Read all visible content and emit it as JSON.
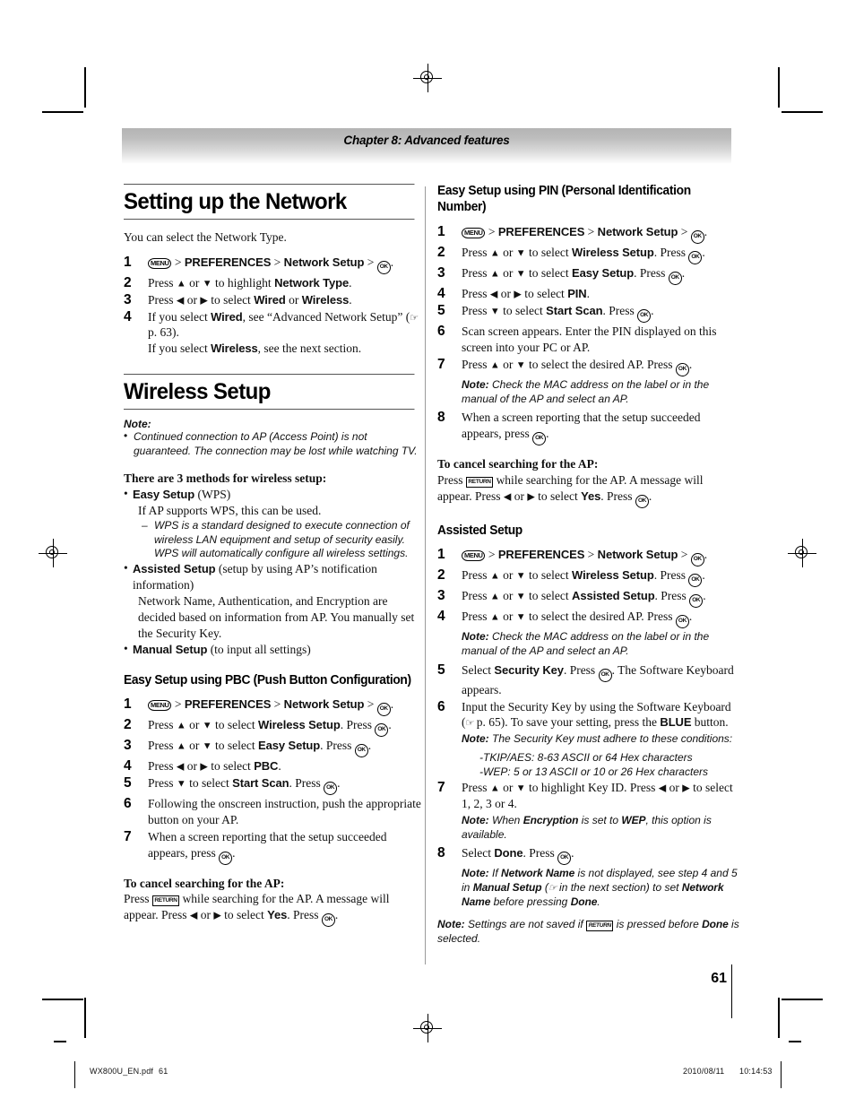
{
  "page": {
    "chapter": "Chapter 8: Advanced features",
    "page_number": "61"
  },
  "footer": {
    "file_label": "WX800U_EN.pdf",
    "file_page": "61",
    "date": "2010/08/11",
    "time": "10:14:53"
  },
  "keys": {
    "menu": "MENU",
    "ok": "OK",
    "return": "RETURN",
    "up": "▲",
    "down": "▼",
    "left": "◀",
    "right": "▶",
    "hand": "☞"
  },
  "left_column": {
    "section_title": "Setting up the Network",
    "intro": "You can select the Network Type.",
    "network_type_steps": [
      {
        "num": "1",
        "kind": "menu-path",
        "pre": "",
        "path": [
          "PREFERENCES",
          "Network Setup"
        ]
      },
      {
        "num": "2",
        "kind": "text",
        "segments": [
          {
            "t": "Press "
          },
          {
            "k": "up"
          },
          {
            "t": " or "
          },
          {
            "k": "down"
          },
          {
            "t": " to highlight "
          },
          {
            "b": "Network Type"
          },
          {
            "t": "."
          }
        ]
      },
      {
        "num": "3",
        "kind": "text",
        "segments": [
          {
            "t": "Press "
          },
          {
            "k": "left"
          },
          {
            "t": " or "
          },
          {
            "k": "right"
          },
          {
            "t": " to select "
          },
          {
            "b": "Wired"
          },
          {
            "t": " or "
          },
          {
            "b": "Wireless"
          },
          {
            "t": "."
          }
        ]
      },
      {
        "num": "4",
        "kind": "text",
        "segments": [
          {
            "t": "If you select "
          },
          {
            "b": "Wired"
          },
          {
            "t": ", see “Advanced Network Setup” ("
          },
          {
            "k": "hand"
          },
          {
            "t": " p. 63)."
          },
          {
            "br": true
          },
          {
            "t": "If you select "
          },
          {
            "b": "Wireless"
          },
          {
            "t": ", see the next section."
          }
        ]
      }
    ],
    "wireless_setup_title": "Wireless Setup",
    "wireless_note_label": "Note:",
    "wireless_note": "Continued connection to AP (Access Point) is not guaranteed. The connection may be lost while watching TV.",
    "methods_heading": "There are 3 methods for wireless setup:",
    "methods": [
      {
        "name": "Easy Setup",
        "qualifier": " (WPS)",
        "detail": "If AP supports WPS, this can be used.",
        "dash_note": "WPS is a standard designed to execute connection of wireless LAN equipment and setup of security easily. WPS will automatically configure all wireless settings."
      },
      {
        "name": "Assisted Setup",
        "qualifier": " (setup by using AP’s notification information)",
        "detail": "Network Name, Authentication, and Encryption are decided based on information from AP. You manually set the Security Key.",
        "dash_note": ""
      },
      {
        "name": "Manual Setup",
        "qualifier": " (to input all settings)",
        "detail": "",
        "dash_note": ""
      }
    ],
    "pbc_title": "Easy Setup using PBC (Push Button Configuration)",
    "pbc_steps": [
      {
        "num": "1",
        "kind": "menu-path",
        "path": [
          "PREFERENCES",
          "Network Setup"
        ]
      },
      {
        "num": "2",
        "kind": "text",
        "segments": [
          {
            "t": "Press "
          },
          {
            "k": "up"
          },
          {
            "t": " or "
          },
          {
            "k": "down"
          },
          {
            "t": " to select "
          },
          {
            "b": "Wireless Setup"
          },
          {
            "t": ". Press "
          },
          {
            "k": "ok"
          },
          {
            "t": "."
          }
        ]
      },
      {
        "num": "3",
        "kind": "text",
        "segments": [
          {
            "t": "Press "
          },
          {
            "k": "up"
          },
          {
            "t": " or "
          },
          {
            "k": "down"
          },
          {
            "t": " to select "
          },
          {
            "b": "Easy Setup"
          },
          {
            "t": ". Press "
          },
          {
            "k": "ok"
          },
          {
            "t": "."
          }
        ]
      },
      {
        "num": "4",
        "kind": "text",
        "segments": [
          {
            "t": "Press "
          },
          {
            "k": "left"
          },
          {
            "t": " or "
          },
          {
            "k": "right"
          },
          {
            "t": " to select "
          },
          {
            "b": "PBC"
          },
          {
            "t": "."
          }
        ]
      },
      {
        "num": "5",
        "kind": "text",
        "segments": [
          {
            "t": "Press "
          },
          {
            "k": "down"
          },
          {
            "t": " to select "
          },
          {
            "b": "Start Scan"
          },
          {
            "t": ". Press "
          },
          {
            "k": "ok"
          },
          {
            "t": "."
          }
        ]
      },
      {
        "num": "6",
        "kind": "text",
        "segments": [
          {
            "t": "Following the onscreen instruction, push the appropriate button on your AP."
          }
        ]
      },
      {
        "num": "7",
        "kind": "text",
        "segments": [
          {
            "t": "When a screen reporting that the setup succeeded appears, press "
          },
          {
            "k": "ok"
          },
          {
            "t": "."
          }
        ]
      }
    ],
    "cancel_heading": "To cancel searching for the AP:",
    "cancel_body": [
      {
        "t": "Press "
      },
      {
        "k": "return"
      },
      {
        "t": " while searching for the AP. A message will appear. Press "
      },
      {
        "k": "left"
      },
      {
        "t": " or "
      },
      {
        "k": "right"
      },
      {
        "t": " to select "
      },
      {
        "b": "Yes"
      },
      {
        "t": ". Press "
      },
      {
        "k": "ok"
      },
      {
        "t": "."
      }
    ]
  },
  "right_column": {
    "pin_title": "Easy Setup using PIN (Personal Identification Number)",
    "pin_steps": [
      {
        "num": "1",
        "kind": "menu-path",
        "path": [
          "PREFERENCES",
          "Network Setup"
        ]
      },
      {
        "num": "2",
        "kind": "text",
        "segments": [
          {
            "t": "Press "
          },
          {
            "k": "up"
          },
          {
            "t": " or "
          },
          {
            "k": "down"
          },
          {
            "t": " to select "
          },
          {
            "b": "Wireless Setup"
          },
          {
            "t": ". Press "
          },
          {
            "k": "ok"
          },
          {
            "t": "."
          }
        ]
      },
      {
        "num": "3",
        "kind": "text",
        "segments": [
          {
            "t": "Press "
          },
          {
            "k": "up"
          },
          {
            "t": " or "
          },
          {
            "k": "down"
          },
          {
            "t": " to select "
          },
          {
            "b": "Easy Setup"
          },
          {
            "t": ". Press "
          },
          {
            "k": "ok"
          },
          {
            "t": "."
          }
        ]
      },
      {
        "num": "4",
        "kind": "text",
        "segments": [
          {
            "t": "Press "
          },
          {
            "k": "left"
          },
          {
            "t": " or "
          },
          {
            "k": "right"
          },
          {
            "t": " to select "
          },
          {
            "b": "PIN"
          },
          {
            "t": "."
          }
        ]
      },
      {
        "num": "5",
        "kind": "text",
        "segments": [
          {
            "t": "Press "
          },
          {
            "k": "down"
          },
          {
            "t": " to select "
          },
          {
            "b": "Start Scan"
          },
          {
            "t": ". Press "
          },
          {
            "k": "ok"
          },
          {
            "t": "."
          }
        ]
      },
      {
        "num": "6",
        "kind": "text",
        "segments": [
          {
            "t": "Scan screen appears. Enter the PIN displayed on this screen into your PC or AP."
          }
        ]
      },
      {
        "num": "7",
        "kind": "text",
        "segments": [
          {
            "t": "Press "
          },
          {
            "k": "up"
          },
          {
            "t": " or "
          },
          {
            "k": "down"
          },
          {
            "t": " to select the desired AP. Press "
          },
          {
            "k": "ok"
          },
          {
            "t": "."
          }
        ],
        "note_label": "Note:",
        "note": "Check the MAC address on the label or in the manual of the AP and select an AP."
      },
      {
        "num": "8",
        "kind": "text",
        "segments": [
          {
            "t": "When a screen reporting that the setup succeeded appears, press "
          },
          {
            "k": "ok"
          },
          {
            "t": "."
          }
        ]
      }
    ],
    "cancel_heading": "To cancel searching for the AP:",
    "cancel_body": [
      {
        "t": "Press "
      },
      {
        "k": "return"
      },
      {
        "t": " while searching for the AP. A message will appear. Press "
      },
      {
        "k": "left"
      },
      {
        "t": " or "
      },
      {
        "k": "right"
      },
      {
        "t": " to select "
      },
      {
        "b": "Yes"
      },
      {
        "t": ". Press "
      },
      {
        "k": "ok"
      },
      {
        "t": "."
      }
    ],
    "assisted_title": "Assisted Setup",
    "assisted_steps": [
      {
        "num": "1",
        "kind": "menu-path",
        "path": [
          "PREFERENCES",
          "Network Setup"
        ]
      },
      {
        "num": "2",
        "kind": "text",
        "segments": [
          {
            "t": "Press "
          },
          {
            "k": "up"
          },
          {
            "t": " or "
          },
          {
            "k": "down"
          },
          {
            "t": " to select "
          },
          {
            "b": "Wireless Setup"
          },
          {
            "t": ". Press "
          },
          {
            "k": "ok"
          },
          {
            "t": "."
          }
        ]
      },
      {
        "num": "3",
        "kind": "text",
        "segments": [
          {
            "t": "Press "
          },
          {
            "k": "up"
          },
          {
            "t": " or "
          },
          {
            "k": "down"
          },
          {
            "t": " to select "
          },
          {
            "b": "Assisted Setup"
          },
          {
            "t": ". Press "
          },
          {
            "k": "ok"
          },
          {
            "t": "."
          }
        ]
      },
      {
        "num": "4",
        "kind": "text",
        "segments": [
          {
            "t": "Press "
          },
          {
            "k": "up"
          },
          {
            "t": " or "
          },
          {
            "k": "down"
          },
          {
            "t": " to select the desired AP. Press "
          },
          {
            "k": "ok"
          },
          {
            "t": "."
          }
        ],
        "note_label": "Note:",
        "note": "Check the MAC address on the label or in the manual of the AP and select an AP."
      },
      {
        "num": "5",
        "kind": "text",
        "segments": [
          {
            "t": "Select "
          },
          {
            "b": "Security Key"
          },
          {
            "t": ". Press "
          },
          {
            "k": "ok"
          },
          {
            "t": ". The Software Keyboard appears."
          }
        ]
      },
      {
        "num": "6",
        "kind": "text",
        "segments": [
          {
            "t": "Input the Security Key by using the Software Keyboard ("
          },
          {
            "k": "hand"
          },
          {
            "t": " p. 65). To save your setting, press the "
          },
          {
            "b": "BLUE"
          },
          {
            "t": " button."
          }
        ],
        "note_label": "Note:",
        "note": "The Security Key must adhere to these conditions:",
        "conditions": [
          "-TKIP/AES: 8-63 ASCII or 64 Hex characters",
          "-WEP: 5 or 13 ASCII or 10 or 26 Hex characters"
        ]
      },
      {
        "num": "7",
        "kind": "text",
        "segments": [
          {
            "t": "Press "
          },
          {
            "k": "up"
          },
          {
            "t": " or "
          },
          {
            "k": "down"
          },
          {
            "t": " to highlight Key ID. Press "
          },
          {
            "k": "left"
          },
          {
            "t": " or "
          },
          {
            "k": "right"
          },
          {
            "t": " to select 1, 2, 3 or 4."
          }
        ],
        "note_label": "Note:",
        "note_segments": [
          {
            "t": "When "
          },
          {
            "b": "Encryption"
          },
          {
            "t": " is set to "
          },
          {
            "b": "WEP"
          },
          {
            "t": ", this option is available."
          }
        ]
      },
      {
        "num": "8",
        "kind": "text",
        "segments": [
          {
            "t": "Select "
          },
          {
            "b": "Done"
          },
          {
            "t": ". Press "
          },
          {
            "k": "ok"
          },
          {
            "t": "."
          }
        ],
        "note_label": "Note:",
        "note_segments": [
          {
            "t": "If "
          },
          {
            "b": "Network Name"
          },
          {
            "t": " is not displayed, see step 4 and 5 in "
          },
          {
            "b": "Manual Setup"
          },
          {
            "t": " ("
          },
          {
            "k": "hand"
          },
          {
            "t": " in the next section) to set "
          },
          {
            "b": "Network Name"
          },
          {
            "t": " before pressing "
          },
          {
            "b": "Done"
          },
          {
            "t": "."
          }
        ]
      }
    ],
    "final_note_label": "Note:",
    "final_note_segments": [
      {
        "t": "Settings are not saved if "
      },
      {
        "k": "return"
      },
      {
        "t": " is pressed before "
      },
      {
        "b": "Done"
      },
      {
        "t": " is selected."
      }
    ]
  }
}
